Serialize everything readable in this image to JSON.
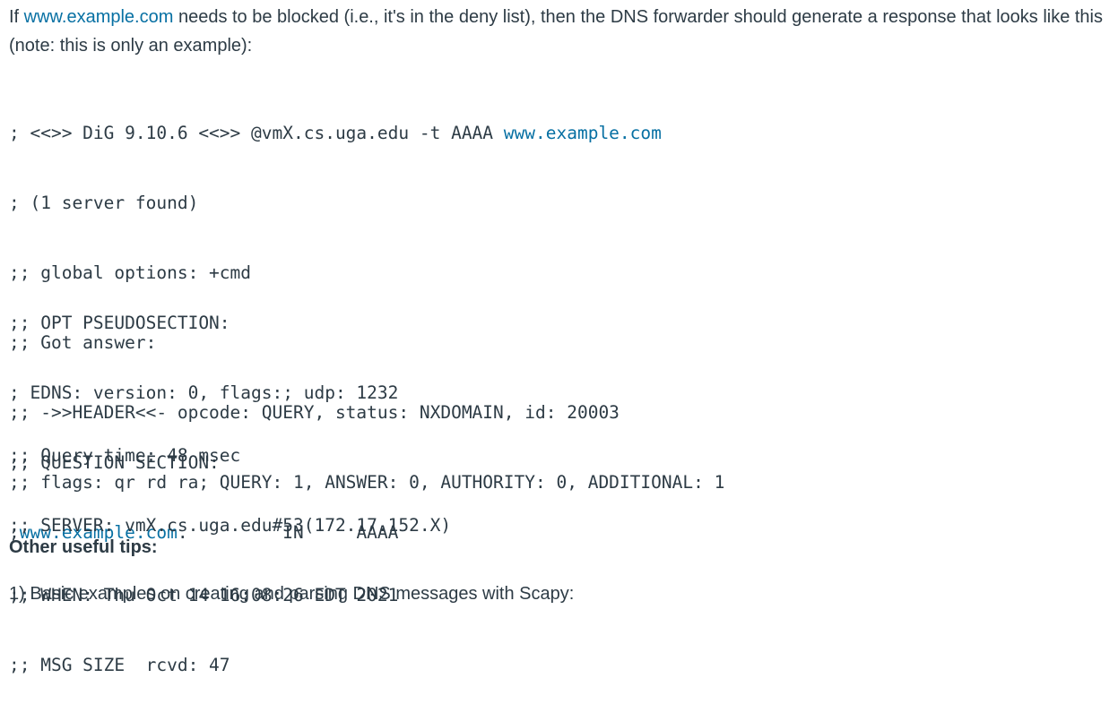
{
  "intro": {
    "pre_link": "If ",
    "link": "www.example.com",
    "post_link": " needs to be blocked (i.e., it's in the deny list), then the DNS forwarder should generate a response that looks like this (note: this is only an example):"
  },
  "dig": {
    "line1_pre": "; <<>> DiG 9.10.6 <<>> @vmX.cs.uga.edu -t AAAA ",
    "line1_link": "www.example.com",
    "line2": "; (1 server found)",
    "line3": ";; global options: +cmd",
    "line4": ";; Got answer:",
    "line5": ";; ->>HEADER<<- opcode: QUERY, status: NXDOMAIN, id: 20003",
    "line6": ";; flags: qr rd ra; QUERY: 1, ANSWER: 0, AUTHORITY: 0, ADDITIONAL: 1",
    "line7": ";; OPT PSEUDOSECTION:",
    "line8": "; EDNS: version: 0, flags:; udp: 1232",
    "line9": ";; QUESTION SECTION:",
    "line10_pre": ";",
    "line10_link": "www.example.com",
    "line10_post": ".         IN     AAAA",
    "line11": ";; Query time: 48 msec",
    "line12": ";; SERVER: vmX.cs.uga.edu#53(172.17.152.X)",
    "line13": ";; WHEN: Thu Oct 14 16:08:26 EDT 2021",
    "line14": ";; MSG SIZE  rcvd: 47"
  },
  "tips": {
    "heading": "Other useful tips:",
    "item1": "1) Basic examples on creating and parsing DNS messages with Scapy:"
  },
  "colors": {
    "text": "#2d3b45",
    "link": "#0770a3"
  }
}
